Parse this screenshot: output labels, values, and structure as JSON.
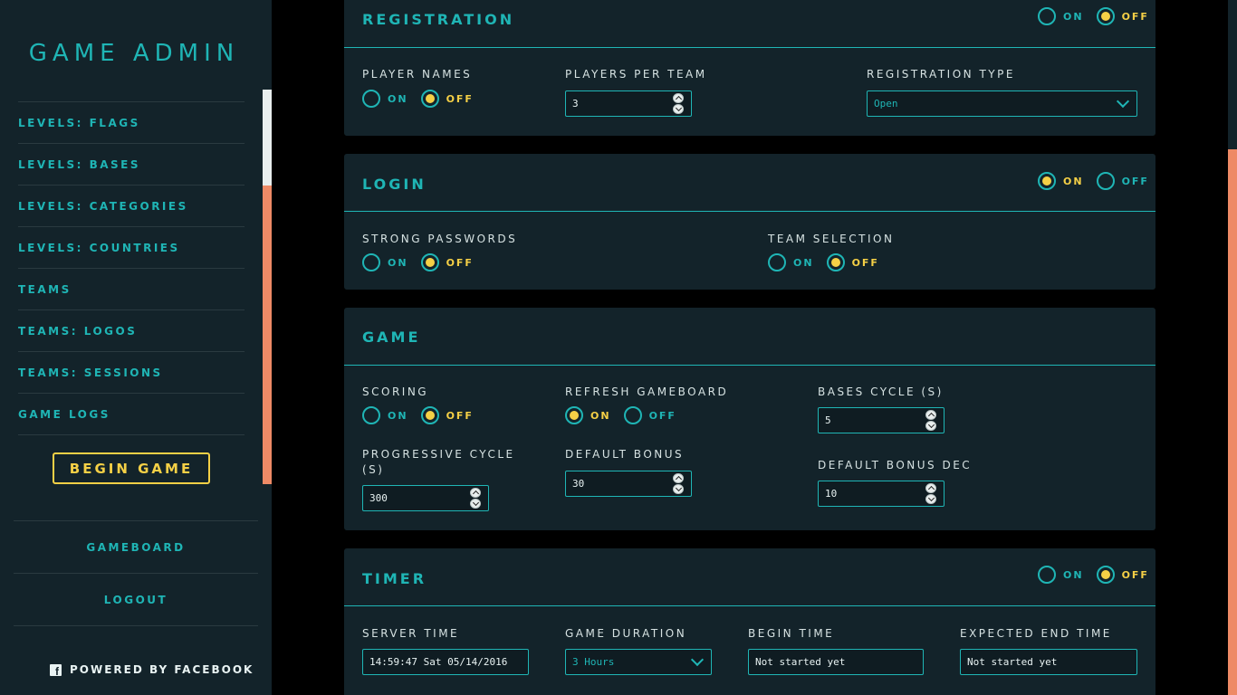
{
  "sidebar": {
    "brand": "GAME ADMIN",
    "nav": [
      {
        "label": "LEVELS: FLAGS"
      },
      {
        "label": "LEVELS: BASES"
      },
      {
        "label": "LEVELS: CATEGORIES"
      },
      {
        "label": "LEVELS: COUNTRIES"
      },
      {
        "label": "TEAMS"
      },
      {
        "label": "TEAMS: LOGOS"
      },
      {
        "label": "TEAMS: SESSIONS"
      },
      {
        "label": "GAME LOGS"
      }
    ],
    "begin_game_label": "BEGIN GAME",
    "gameboard_label": "GAMEBOARD",
    "logout_label": "LOGOUT",
    "powered_by": "POWERED BY FACEBOOK",
    "powered_icon": "facebook-icon"
  },
  "common": {
    "on": "ON",
    "off": "OFF"
  },
  "registration": {
    "title": "REGISTRATION",
    "enabled": "off",
    "player_names_label": "PLAYER NAMES",
    "player_names": "off",
    "players_per_team_label": "PLAYERS PER TEAM",
    "players_per_team": "3",
    "registration_type_label": "REGISTRATION TYPE",
    "registration_type": "Open"
  },
  "login": {
    "title": "LOGIN",
    "enabled": "on",
    "strong_passwords_label": "STRONG PASSWORDS",
    "strong_passwords": "off",
    "team_selection_label": "TEAM SELECTION",
    "team_selection": "off"
  },
  "game": {
    "title": "GAME",
    "scoring_label": "SCORING",
    "scoring": "off",
    "refresh_label": "REFRESH GAMEBOARD",
    "refresh": "on",
    "bases_cycle_label": "BASES CYCLE (S)",
    "bases_cycle": "5",
    "progressive_cycle_label": "PROGRESSIVE CYCLE (S)",
    "progressive_cycle": "300",
    "default_bonus_label": "DEFAULT BONUS",
    "default_bonus": "30",
    "default_bonus_dec_label": "DEFAULT BONUS DEC",
    "default_bonus_dec": "10"
  },
  "timer": {
    "title": "TIMER",
    "enabled": "off",
    "server_time_label": "SERVER TIME",
    "server_time": "14:59:47 Sat 05/14/2016",
    "game_duration_label": "GAME DURATION",
    "game_duration": "3 Hours",
    "begin_time_label": "BEGIN TIME",
    "begin_time": "Not started yet",
    "expected_end_label": "EXPECTED END TIME",
    "expected_end": "Not started yet"
  },
  "colors": {
    "accent": "#1fb5b5",
    "highlight": "#f5d046",
    "scrollbar": "#ee8a66",
    "panel": "#13232a"
  }
}
